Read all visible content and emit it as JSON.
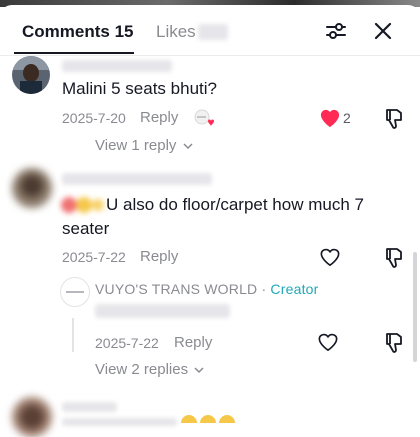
{
  "tabs": {
    "comments_label": "Comments 15",
    "likes_label": "Likes"
  },
  "comments": [
    {
      "text": "Malini 5 seats bhuti?",
      "date": "2025-7-20",
      "reply_label": "Reply",
      "like_count": "2",
      "liked": true,
      "view_replies": "View 1 reply"
    },
    {
      "text": "U also do floor/carpet how much 7 seater",
      "date": "2025-7-22",
      "reply_label": "Reply",
      "view_replies": "View 2 replies"
    }
  ],
  "creator_reply": {
    "name": "VUYO'S TRANS WORLD",
    "separator": " · ",
    "badge": "Creator",
    "date": "2025-7-22",
    "reply_label": "Reply"
  },
  "colors": {
    "liked": "#fe2c55",
    "creator": "#20a8b8",
    "muted": "#8a8b91"
  },
  "icons": [
    "filter-icon",
    "close-icon",
    "heart-icon",
    "dislike-icon",
    "chevron-down-icon",
    "love-sticker-icon"
  ]
}
